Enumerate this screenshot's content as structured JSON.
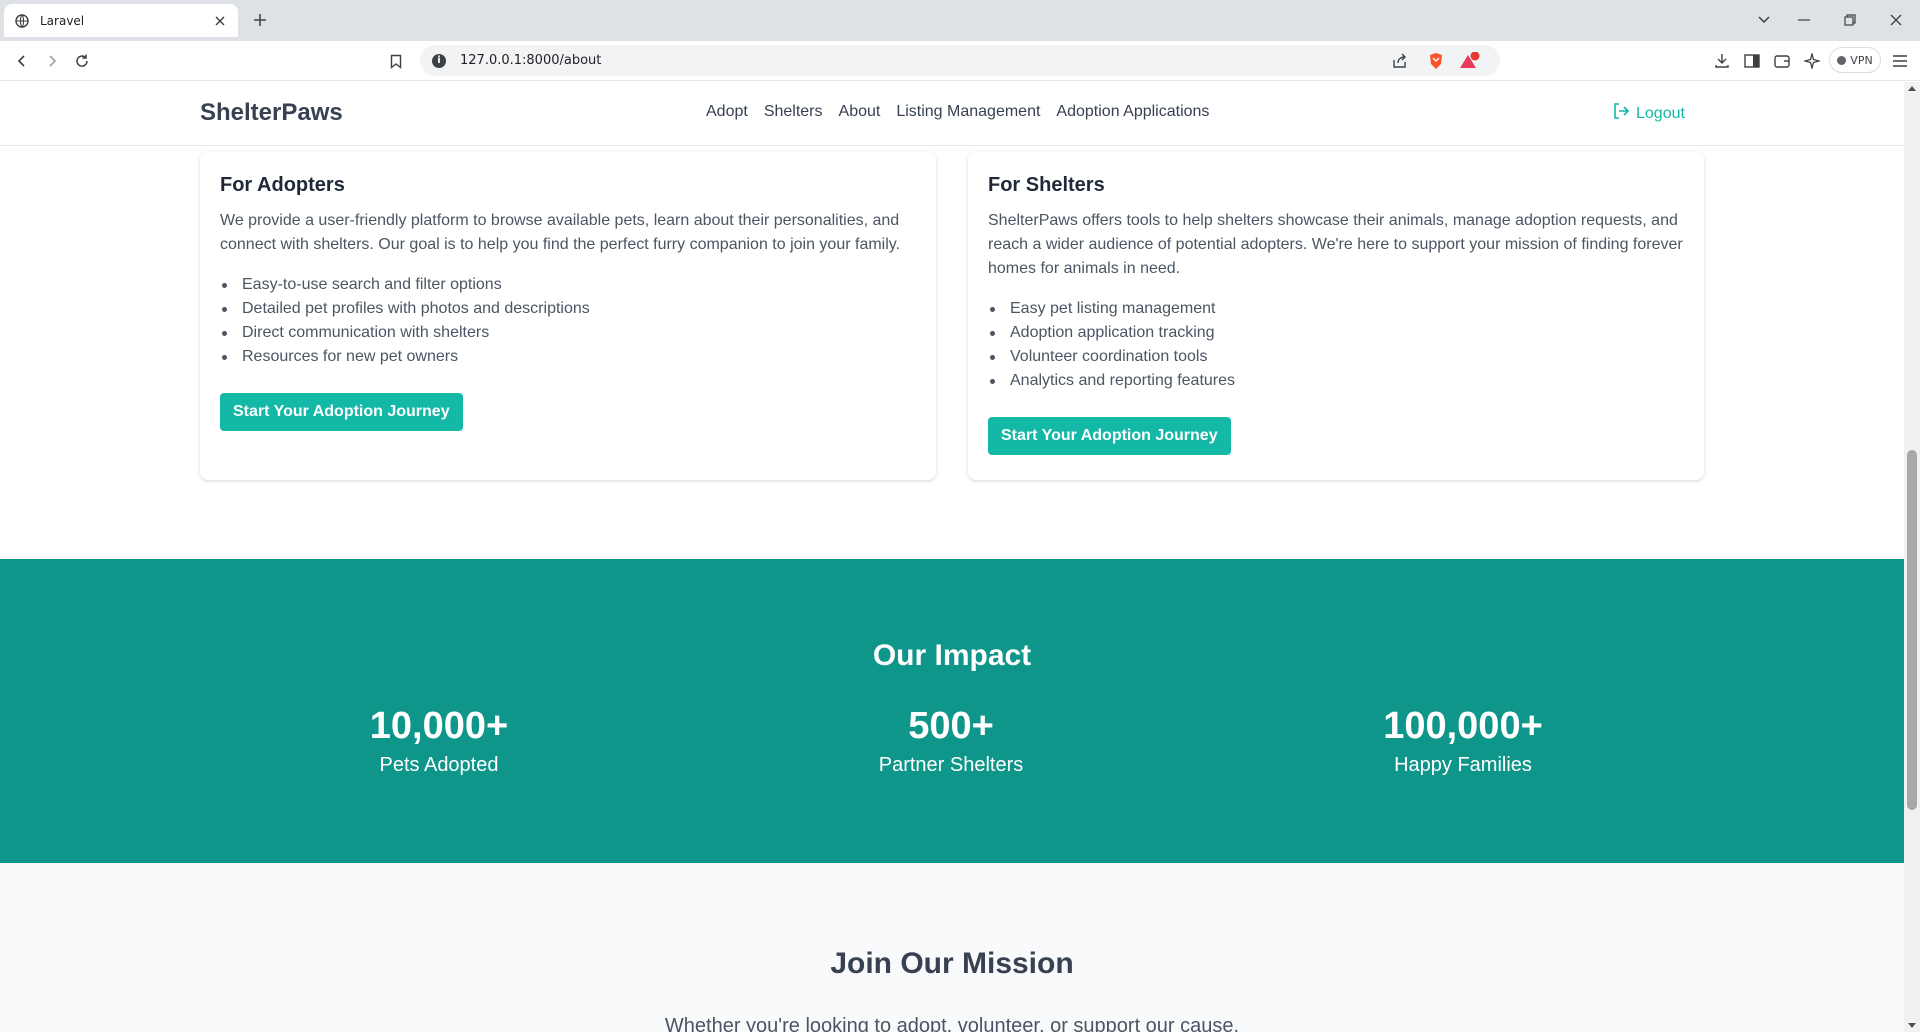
{
  "browser": {
    "tab_title": "Laravel",
    "url": "127.0.0.1:8000/about",
    "vpn_label": "VPN",
    "notification_count": "1"
  },
  "site": {
    "brand": "ShelterPaws",
    "nav": [
      "Adopt",
      "Shelters",
      "About",
      "Listing Management",
      "Adoption Applications"
    ],
    "logout_label": "Logout"
  },
  "adopters": {
    "title": "For Adopters",
    "description": "We provide a user-friendly platform to browse available pets, learn about their personalities, and connect with shelters. Our goal is to help you find the perfect furry companion to join your family.",
    "features": [
      "Easy-to-use search and filter options",
      "Detailed pet profiles with photos and descriptions",
      "Direct communication with shelters",
      "Resources for new pet owners"
    ],
    "button": "Start Your Adoption Journey"
  },
  "shelters": {
    "title": "For Shelters",
    "description": "ShelterPaws offers tools to help shelters showcase their animals, manage adoption requests, and reach a wider audience of potential adopters. We're here to support your mission of finding forever homes for animals in need.",
    "features": [
      "Easy pet listing management",
      "Adoption application tracking",
      "Volunteer coordination tools",
      "Analytics and reporting features"
    ],
    "button": "Start Your Adoption Journey"
  },
  "impact": {
    "title": "Our Impact",
    "stats": [
      {
        "value": "10,000+",
        "label": "Pets Adopted"
      },
      {
        "value": "500+",
        "label": "Partner Shelters"
      },
      {
        "value": "100,000+",
        "label": "Happy Families"
      }
    ]
  },
  "mission": {
    "title": "Join Our Mission",
    "text": "Whether you're looking to adopt, volunteer, or support our cause,"
  },
  "colors": {
    "accent": "#14b8a6",
    "impact_bg": "#0f968a"
  }
}
